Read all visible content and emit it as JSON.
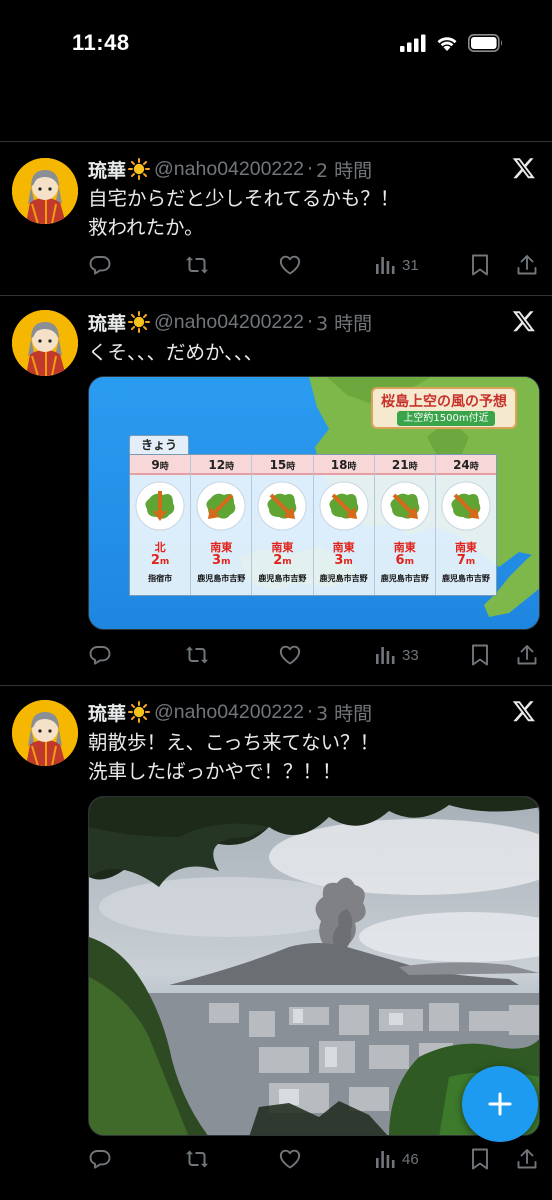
{
  "status_bar": {
    "time": "11:48"
  },
  "tweets": [
    {
      "name": "琉華",
      "handle": "@naho04200222",
      "separator": "·",
      "time": "2 時間",
      "lines": [
        "自宅からだと少しそれてるかも？！",
        "救われたか。"
      ],
      "views": "31"
    },
    {
      "name": "琉華",
      "handle": "@naho04200222",
      "separator": "·",
      "time": "3 時間",
      "lines": [
        "くそ、、、だめか、、、"
      ],
      "views": "33",
      "forecast": {
        "title": "桜島上空の風の予想",
        "subtitle": "上空約1500m付近",
        "day": "きょう",
        "columns": [
          {
            "hour": "9",
            "unit": "時",
            "dir": "北",
            "speed": "2",
            "speed_unit": "m",
            "place": "指宿市"
          },
          {
            "hour": "12",
            "unit": "時",
            "dir": "南東",
            "speed": "3",
            "speed_unit": "m",
            "place": "鹿児島市吉野"
          },
          {
            "hour": "15",
            "unit": "時",
            "dir": "南東",
            "speed": "2",
            "speed_unit": "m",
            "place": "鹿児島市吉野"
          },
          {
            "hour": "18",
            "unit": "時",
            "dir": "南東",
            "speed": "3",
            "speed_unit": "m",
            "place": "鹿児島市吉野"
          },
          {
            "hour": "21",
            "unit": "時",
            "dir": "南東",
            "speed": "6",
            "speed_unit": "m",
            "place": "鹿児島市吉野"
          },
          {
            "hour": "24",
            "unit": "時",
            "dir": "南東",
            "speed": "7",
            "speed_unit": "m",
            "place": "鹿児島市吉野"
          }
        ]
      }
    },
    {
      "name": "琉華",
      "handle": "@naho04200222",
      "separator": "·",
      "time": "3 時間",
      "lines": [
        "朝散歩！え、こっち来てない？！",
        "洗車したばっかやで！？！！"
      ],
      "views": "46"
    }
  ],
  "colors": {
    "background": "#000000",
    "text": "#e7e9ea",
    "muted": "#71767b",
    "accent": "#1d9bf0",
    "divider": "#2f3336"
  },
  "icons": {
    "reply": "reply-icon",
    "retweet": "retweet-icon",
    "like": "heart-icon",
    "views": "views-icon",
    "bookmark": "bookmark-icon",
    "share": "share-icon",
    "compose": "plus-icon"
  }
}
